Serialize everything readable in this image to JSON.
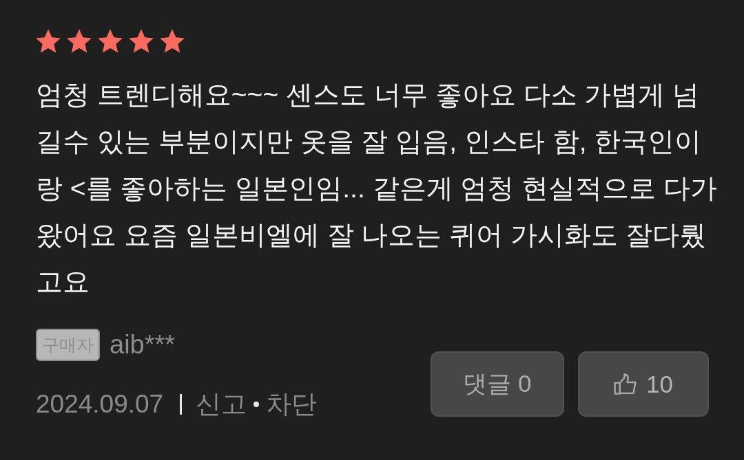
{
  "review": {
    "stars": 5,
    "text": "엄청 트렌디해요~~~ 센스도 너무 좋아요 다소 가볍게 넘길수 있는 부분이지만 옷을 잘 입음, 인스타 함, 한국인이랑 <를 좋아하는 일본인임... 같은게 엄청 현실적으로 다가왔어요 요즘 일본비엘에 잘 나오는 퀴어 가시화도 잘다뤘고요"
  },
  "author": {
    "badge": "구매자",
    "name": "aib***"
  },
  "date": "2024.09.07",
  "actions": [
    {
      "label": "신고"
    },
    {
      "label": "차단"
    }
  ],
  "buttons": {
    "comment": {
      "label": "댓글 0"
    },
    "like": {
      "count": "10"
    }
  }
}
